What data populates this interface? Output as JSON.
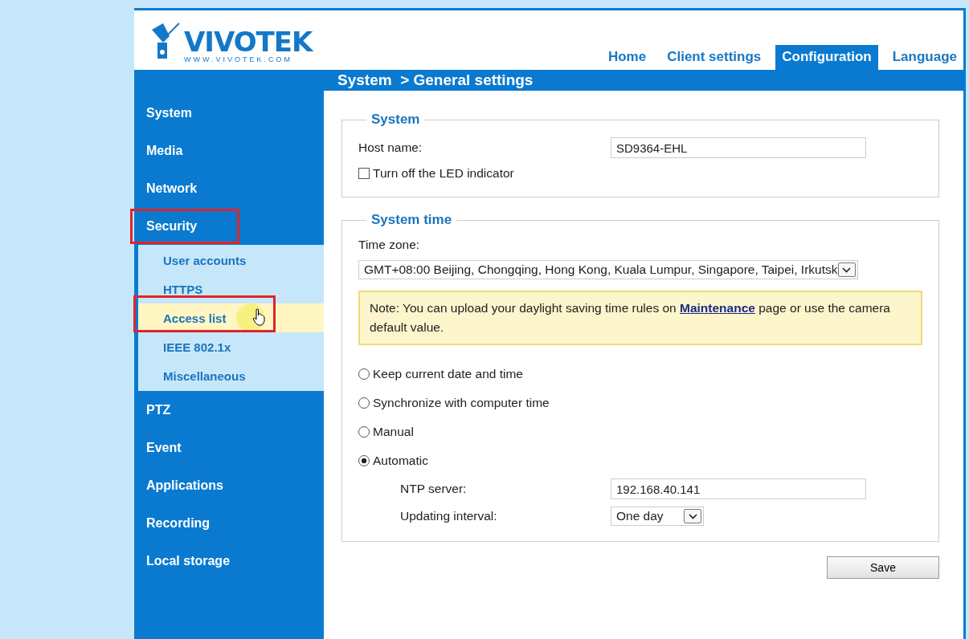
{
  "logo": {
    "brand": "VIVOTEK",
    "url": "WWW.VIVOTEK.COM"
  },
  "tabs": [
    {
      "label": "Home",
      "selected": false
    },
    {
      "label": "Client settings",
      "selected": false
    },
    {
      "label": "Configuration",
      "selected": true
    },
    {
      "label": "Language",
      "selected": false
    }
  ],
  "breadcrumb": "System  > General settings",
  "sidebar": {
    "items": [
      {
        "label": "System",
        "highlighted": false
      },
      {
        "label": "Media",
        "highlighted": false
      },
      {
        "label": "Network",
        "highlighted": false
      },
      {
        "label": "Security",
        "highlighted": true,
        "children": [
          {
            "label": "User accounts",
            "hovered": false,
            "highlighted": false
          },
          {
            "label": "HTTPS",
            "hovered": false,
            "highlighted": false
          },
          {
            "label": "Access list",
            "hovered": true,
            "highlighted": true
          },
          {
            "label": "IEEE 802.1x",
            "hovered": false,
            "highlighted": false
          },
          {
            "label": "Miscellaneous",
            "hovered": false,
            "highlighted": false
          }
        ]
      },
      {
        "label": "PTZ",
        "highlighted": false
      },
      {
        "label": "Event",
        "highlighted": false
      },
      {
        "label": "Applications",
        "highlighted": false
      },
      {
        "label": "Recording",
        "highlighted": false
      },
      {
        "label": "Local storage",
        "highlighted": false
      }
    ]
  },
  "system": {
    "legend": "System",
    "host_label": "Host name:",
    "host_value": "SD9364-EHL",
    "led_label": "Turn off the LED indicator",
    "led_checked": false
  },
  "system_time": {
    "legend": "System time",
    "timezone_label": "Time zone:",
    "timezone_value": "GMT+08:00 Beijing, Chongqing, Hong Kong, Kuala Lumpur, Singapore, Taipei, Irkutsk",
    "note": {
      "before": "Note: You can upload your daylight saving time rules on ",
      "link": "Maintenance",
      "after": " page or use the camera default value."
    },
    "options": [
      {
        "label": "Keep current date and time",
        "selected": false
      },
      {
        "label": "Synchronize with computer time",
        "selected": false
      },
      {
        "label": "Manual",
        "selected": false
      },
      {
        "label": "Automatic",
        "selected": true
      }
    ],
    "ntp_label": "NTP server:",
    "ntp_value": "192.168.40.141",
    "interval_label": "Updating interval:",
    "interval_value": "One day"
  },
  "save": "Save"
}
